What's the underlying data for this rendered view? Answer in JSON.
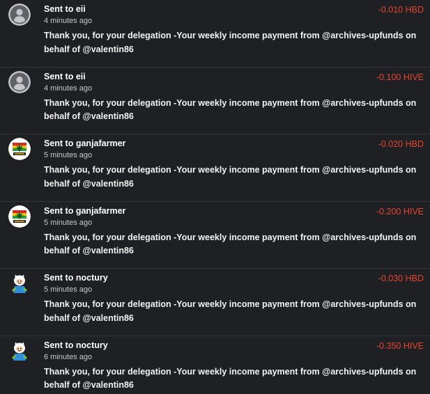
{
  "transactions": [
    {
      "prefix": "Sent to",
      "recipient": "eii",
      "time": "4 minutes ago",
      "amount": "-0.010 HBD",
      "memo": "Thank you, for your delegation -Your weekly income payment from @archives-upfunds on behalf of @valentin86",
      "avatar": "default-user-icon"
    },
    {
      "prefix": "Sent to",
      "recipient": "eii",
      "time": "4 minutes ago",
      "amount": "-0.100 HIVE",
      "memo": "Thank you, for your delegation -Your weekly income payment from @archives-upfunds on behalf of @valentin86",
      "avatar": "default-user-icon"
    },
    {
      "prefix": "Sent to",
      "recipient": "ganjafarmer",
      "time": "5 minutes ago",
      "amount": "-0.020 HBD",
      "memo": "Thank you, for your delegation -Your weekly income payment from @archives-upfunds on behalf of @valentin86",
      "avatar": "ganja-leaf-logo"
    },
    {
      "prefix": "Sent to",
      "recipient": "ganjafarmer",
      "time": "5 minutes ago",
      "amount": "-0.200 HIVE",
      "memo": "Thank you, for your delegation -Your weekly income payment from @archives-upfunds on behalf of @valentin86",
      "avatar": "ganja-leaf-logo"
    },
    {
      "prefix": "Sent to",
      "recipient": "noctury",
      "time": "5 minutes ago",
      "amount": "-0.030 HBD",
      "memo": "Thank you, for your delegation -Your weekly income payment from @archives-upfunds on behalf of @valentin86",
      "avatar": "cartoon-character-avatar"
    },
    {
      "prefix": "Sent to",
      "recipient": "noctury",
      "time": "6 minutes ago",
      "amount": "-0.350 HIVE",
      "memo": "Thank you, for your delegation -Your weekly income payment from @archives-upfunds on behalf of @valentin86",
      "avatar": "cartoon-character-avatar"
    }
  ],
  "colors": {
    "background": "#1e2024",
    "amount": "#e8452f",
    "divider": "#33363b"
  }
}
